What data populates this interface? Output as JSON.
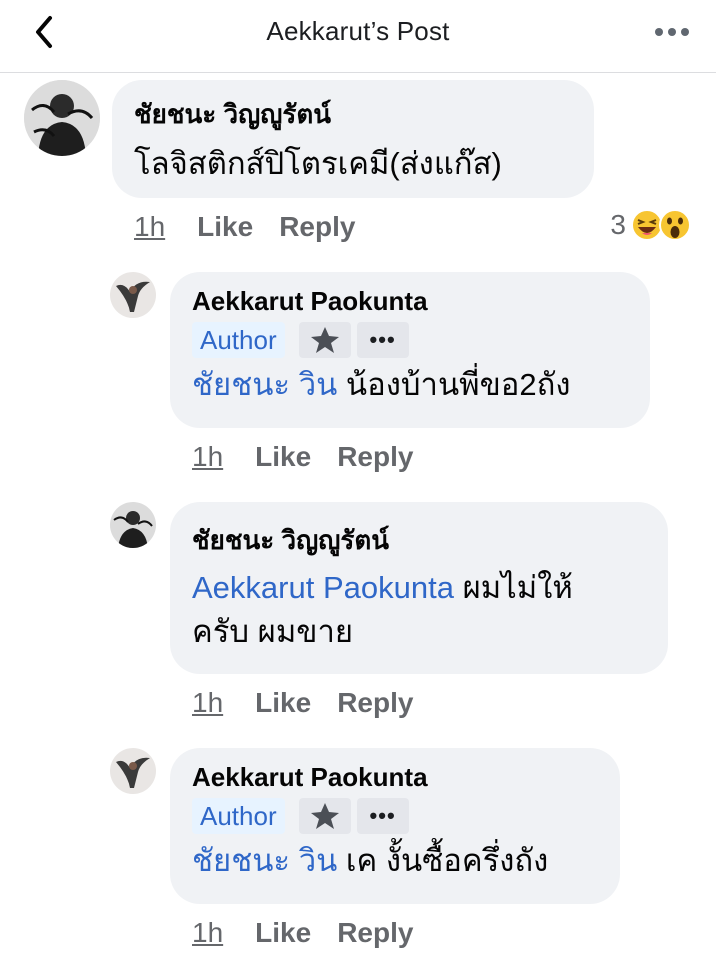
{
  "header": {
    "title": "Aekkarut’s Post",
    "back_icon": "chevron-left-icon",
    "more_icon": "more-horizontal-icon"
  },
  "colors": {
    "bubble": "#f0f2f5",
    "mention": "#2f67c8",
    "author_badge_bg": "#e7f3ff",
    "meta_text": "#65676b"
  },
  "comments": [
    {
      "author": "ชัยชนะ วิญญูรัตน์",
      "text": "โลจิสติกส์ปิโตรเคมี(ส่งแก๊ส)",
      "time": "1h",
      "like": "Like",
      "reply": "Reply",
      "reaction_count": "3",
      "reaction_icons": [
        "haha-icon",
        "wow-icon"
      ]
    },
    {
      "author": "Aekkarut Paokunta",
      "badge": "Author",
      "mention": "ชัยชนะ วิน",
      "text": " น้องบ้านพี่ขอ2ถัง",
      "time": "1h",
      "like": "Like",
      "reply": "Reply"
    },
    {
      "author": "ชัยชนะ วิญญูรัตน์",
      "mention": "Aekkarut Paokunta",
      "text_line1": " ผมไม่ให้",
      "text_line2": "ครับ ผมขาย",
      "time": "1h",
      "like": "Like",
      "reply": "Reply"
    },
    {
      "author": "Aekkarut Paokunta",
      "badge": "Author",
      "mention": "ชัยชนะ วิน",
      "text": " เค งั้นซื้อครึ่งถัง",
      "time": "1h",
      "like": "Like",
      "reply": "Reply"
    }
  ]
}
